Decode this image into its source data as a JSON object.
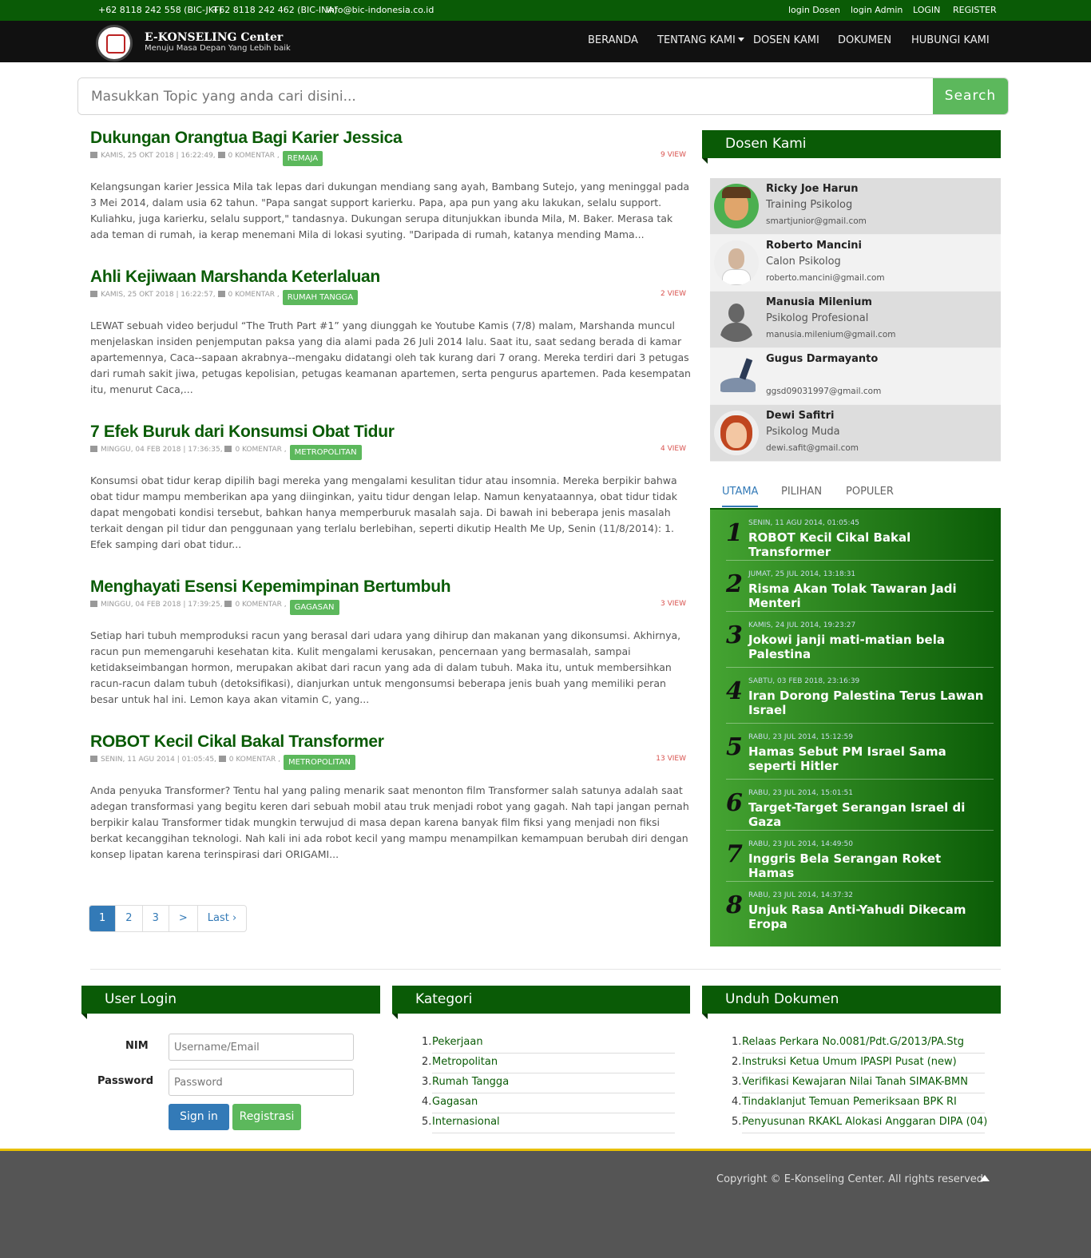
{
  "topbar": {
    "phone1": "+62 8118 242 558 (BIC-JKT)",
    "phone2": "+62 8118 242 462 (BIC-INA)",
    "email": "info@bic-indonesia.co.id",
    "login_dosen": "login Dosen",
    "login_admin": "login Admin",
    "login": "LOGIN",
    "register": "REGISTER"
  },
  "navbar": {
    "brand": "E-KONSELING Center",
    "tagline": "Menuju Masa Depan Yang Lebih baik",
    "items": [
      "BERANDA",
      "TENTANG KAMI",
      "DOSEN KAMI",
      "DOKUMEN",
      "HUBUNGI KAMI"
    ]
  },
  "search": {
    "placeholder": "Masukkan Topic yang anda cari disini...",
    "button": "Search"
  },
  "articles": [
    {
      "title": "Dukungan Orangtua Bagi Karier Jessica",
      "meta": "KAMIS, 25 OKT 2018 | 16:22:49,",
      "comments": "0 KOMENTAR ,",
      "tag": "REMAJA",
      "views": "9 VIEW",
      "body": "Kelangsungan karier Jessica Mila tak lepas dari dukungan mendiang sang ayah, Bambang Sutejo, yang meninggal pada 3 Mei 2014, dalam usia 62 tahun.  \"Papa sangat support karierku. Papa, apa pun yang aku lakukan, selalu support. Kuliahku, juga karierku, selalu support,\" tandasnya.  Dukungan serupa ditunjukkan ibunda Mila, M. Baker. Merasa tak ada teman di rumah, ia kerap menemani Mila di lokasi syuting.  \"Daripada di rumah, katanya mending Mama..."
    },
    {
      "title": "Ahli Kejiwaan Marshanda Keterlaluan",
      "meta": "KAMIS, 25 OKT 2018 | 16:22:57,",
      "comments": "0 KOMENTAR ,",
      "tag": "RUMAH TANGGA",
      "views": "2 VIEW",
      "body": "LEWAT sebuah video berjudul “The Truth Part #1” yang diunggah ke Youtube Kamis (7/8) malam, Marshanda muncul menjelaskan insiden penjemputan paksa yang dia alami pada 26 Juli 2014 lalu. Saat itu, saat sedang berada di kamar apartemennya, Caca--sapaan akrabnya--mengaku didatangi oleh tak kurang dari 7 orang. Mereka terdiri dari 3 petugas dari rumah sakit jiwa, petugas kepolisian, petugas keamanan apartemen, serta pengurus apartemen. Pada kesempatan itu, menurut Caca,..."
    },
    {
      "title": "7 Efek Buruk dari Konsumsi Obat Tidur",
      "meta": "MINGGU, 04 FEB 2018 | 17:36:35,",
      "comments": "0 KOMENTAR ,",
      "tag": "METROPOLITAN",
      "views": "4 VIEW",
      "body": "Konsumsi obat tidur kerap dipilih bagi mereka yang mengalami kesulitan tidur atau insomnia. Mereka berpikir bahwa obat tidur mampu memberikan apa yang diinginkan, yaitu tidur dengan lelap. Namun kenyataannya, obat tidur tidak dapat mengobati kondisi tersebut, bahkan hanya memperburuk masalah saja.  Di bawah ini beberapa jenis masalah terkait dengan pil tidur dan penggunaan yang terlalu berlebihan, seperti dikutip Health Me Up, Senin (11/8/2014): 1. Efek samping dari obat tidur..."
    },
    {
      "title": "Menghayati Esensi Kepemimpinan Bertumbuh",
      "meta": "MINGGU, 04 FEB 2018 | 17:39:25,",
      "comments": "0 KOMENTAR ,",
      "tag": "GAGASAN",
      "views": "3 VIEW",
      "body": "Setiap hari tubuh memproduksi racun yang berasal dari udara yang dihirup dan makanan yang dikonsumsi. Akhirnya, racun pun memengaruhi kesehatan kita. Kulit mengalami kerusakan, pencernaan yang bermasalah, sampai ketidakseimbangan hormon, merupakan akibat dari racun yang ada di dalam tubuh. Maka itu, untuk membersihkan racun-racun dalam tubuh (detoksifikasi), dianjurkan untuk mengonsumsi beberapa jenis buah yang memiliki peran besar untuk hal ini.  Lemon kaya akan vitamin C, yang..."
    },
    {
      "title": "ROBOT Kecil Cikal Bakal Transformer",
      "meta": "SENIN, 11 AGU 2014 | 01:05:45,",
      "comments": "0 KOMENTAR ,",
      "tag": "METROPOLITAN",
      "views": "13 VIEW",
      "body": "Anda penyuka Transformer? Tentu hal yang paling menarik saat menonton film Transformer salah satunya adalah saat adegan transformasi yang begitu keren dari sebuah mobil atau truk menjadi robot yang gagah. Nah tapi jangan pernah berpikir kalau Transformer tidak mungkin terwujud di masa depan karena banyak film fiksi yang menjadi non fiksi berkat kecanggihan teknologi. Nah kali ini ada robot kecil yang mampu menampilkan kemampuan berubah diri dengan konsep lipatan karena terinspirasi dari ORIGAMI..."
    }
  ],
  "pagination": [
    "1",
    "2",
    "3",
    ">",
    "Last ›"
  ],
  "dosen_widget": {
    "title": "Dosen Kami",
    "items": [
      {
        "name": "Ricky Joe Harun",
        "role": "Training Psikolog",
        "email": "smartjunior@gmail.com"
      },
      {
        "name": "Roberto Mancini",
        "role": "Calon Psikolog",
        "email": "roberto.mancini@gmail.com"
      },
      {
        "name": "Manusia Milenium",
        "role": "Psikolog Profesional",
        "email": "manusia.milenium@gmail.com"
      },
      {
        "name": "Gugus Darmayanto",
        "role": "",
        "email": "ggsd09031997@gmail.com"
      },
      {
        "name": "Dewi Safitri",
        "role": "Psikolog Muda",
        "email": "dewi.safit@gmail.com"
      }
    ]
  },
  "tabs": [
    "UTAMA",
    "PILIHAN",
    "POPULER"
  ],
  "popular": [
    {
      "num": "1",
      "date": "SENIN, 11 AGU 2014, 01:05:45",
      "title": "ROBOT Kecil Cikal Bakal Transformer"
    },
    {
      "num": "2",
      "date": "JUMAT, 25 JUL 2014, 13:18:31",
      "title": "Risma Akan Tolak Tawaran Jadi Menteri"
    },
    {
      "num": "3",
      "date": "KAMIS, 24 JUL 2014, 19:23:27",
      "title": "Jokowi janji mati-matian bela Palestina"
    },
    {
      "num": "4",
      "date": "SABTU, 03 FEB 2018, 23:16:39",
      "title": "Iran Dorong Palestina Terus Lawan Israel"
    },
    {
      "num": "5",
      "date": "RABU, 23 JUL 2014, 15:12:59",
      "title": "Hamas Sebut PM Israel Sama seperti Hitler"
    },
    {
      "num": "6",
      "date": "RABU, 23 JUL 2014, 15:01:51",
      "title": "Target-Target Serangan Israel di Gaza"
    },
    {
      "num": "7",
      "date": "RABU, 23 JUL 2014, 14:49:50",
      "title": "Inggris Bela Serangan Roket Hamas"
    },
    {
      "num": "8",
      "date": "RABU, 23 JUL 2014, 14:37:32",
      "title": "Unjuk Rasa Anti-Yahudi Dikecam Eropa"
    }
  ],
  "login_widget": {
    "title": "User Login",
    "nim_label": "NIM",
    "nim_placeholder": "Username/Email",
    "password_label": "Password",
    "password_placeholder": "Password",
    "signin": "Sign in",
    "register": "Registrasi"
  },
  "kategori": {
    "title": "Kategori",
    "items": [
      "Pekerjaan",
      "Metropolitan",
      "Rumah Tangga",
      "Gagasan",
      "Internasional"
    ]
  },
  "unduh": {
    "title": "Unduh Dokumen",
    "items": [
      "Relaas Perkara No.0081/Pdt.G/2013/PA.Stg",
      "Instruksi Ketua Umum IPASPI Pusat (new)",
      "Verifikasi Kewajaran Nilai Tanah SIMAK-BMN",
      "Tindaklanjut Temuan Pemeriksaan BPK RI",
      "Penyusunan RKAKL Alokasi Anggaran DIPA (04)"
    ]
  },
  "footer": {
    "copyright": "Copyright © E-Konseling Center. All rights reserved"
  },
  "colors": {
    "brand_green": "#0a5b06",
    "accent_green": "#5cb85c",
    "link_blue": "#337ab7"
  }
}
